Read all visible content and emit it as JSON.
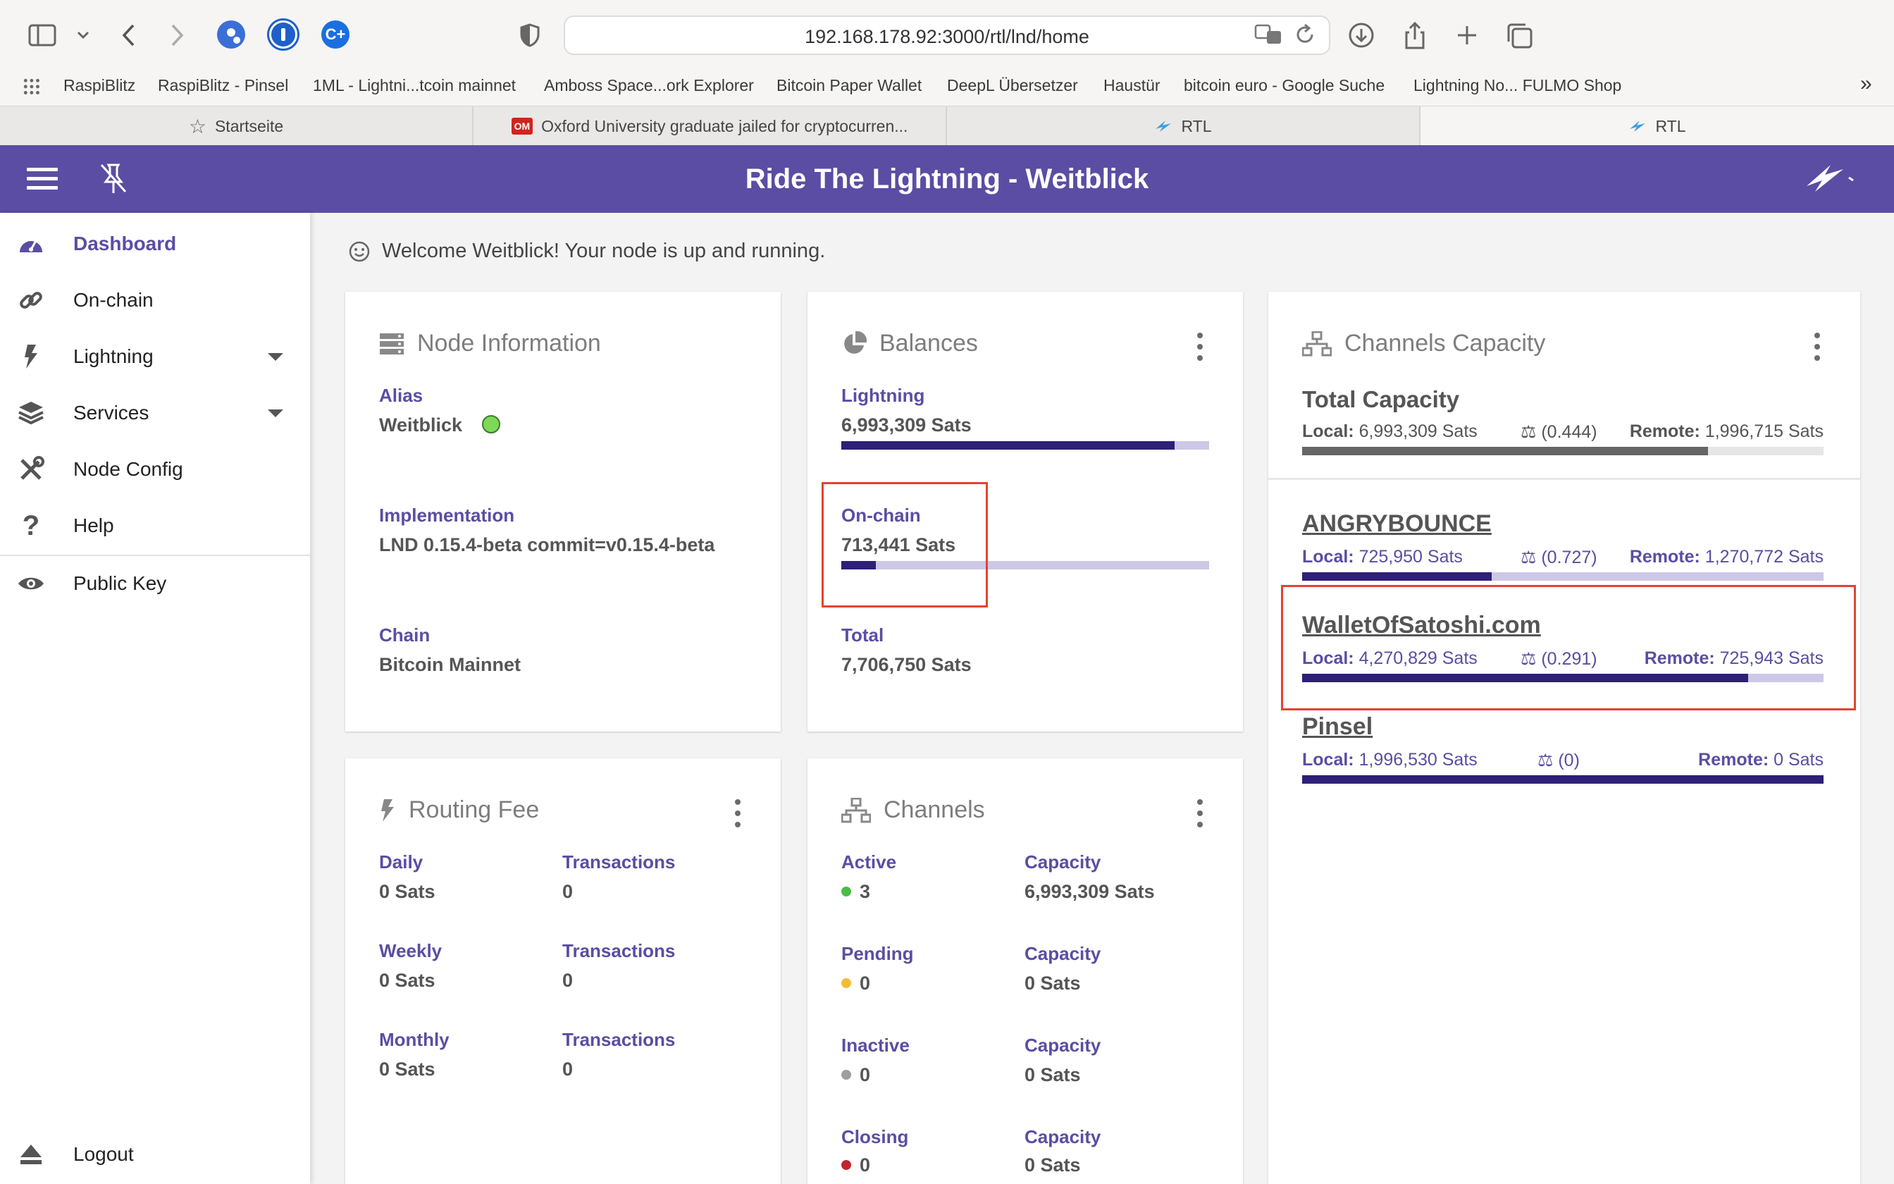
{
  "browser": {
    "url": "192.168.178.92:3000/rtl/lnd/home",
    "bookmarks": [
      "RaspiBlitz",
      "RaspiBlitz - Pinsel",
      "1ML - Lightni...tcoin mainnet",
      "Amboss Space...ork Explorer",
      "Bitcoin Paper Wallet",
      "DeepL Übersetzer",
      "Haustür",
      "bitcoin euro - Google Suche",
      "Lightning No... FULMO Shop"
    ],
    "tabs": [
      {
        "label": "Startseite",
        "icon": "star-icon"
      },
      {
        "label": "Oxford University graduate jailed for cryptocurren...",
        "icon": "om-favicon"
      },
      {
        "label": "RTL",
        "icon": "rtl-favicon"
      },
      {
        "label": "RTL",
        "icon": "rtl-favicon"
      }
    ],
    "extension_badge": "C+"
  },
  "app": {
    "title": "Ride The Lightning - Weitblick",
    "welcome": "Welcome Weitblick! Your node is up and running."
  },
  "sidebar": {
    "items": [
      {
        "label": "Dashboard",
        "icon": "dashboard-icon"
      },
      {
        "label": "On-chain",
        "icon": "link-icon"
      },
      {
        "label": "Lightning",
        "icon": "bolt-icon"
      },
      {
        "label": "Services",
        "icon": "layers-icon"
      },
      {
        "label": "Node Config",
        "icon": "tools-icon"
      },
      {
        "label": "Help",
        "icon": "help-icon"
      },
      {
        "label": "Public Key",
        "icon": "eye-icon"
      }
    ],
    "logout": "Logout"
  },
  "node_info": {
    "title": "Node Information",
    "alias_label": "Alias",
    "alias": "Weitblick",
    "alias_color": "#7ed957",
    "impl_label": "Implementation",
    "impl": "LND 0.15.4-beta commit=v0.15.4-beta",
    "chain_label": "Chain",
    "chain": "Bitcoin Mainnet"
  },
  "balances": {
    "title": "Balances",
    "lightning_label": "Lightning",
    "lightning": "6,993,309 Sats",
    "lightning_fraction": 0.907,
    "onchain_label": "On-chain",
    "onchain": "713,441 Sats",
    "onchain_fraction": 0.093,
    "total_label": "Total",
    "total": "7,706,750 Sats"
  },
  "channels_capacity": {
    "title": "Channels Capacity",
    "total_label": "Total Capacity",
    "local_key": "Local:",
    "remote_key": "Remote:",
    "total_local": "6,993,309 Sats",
    "total_ratio": "(0.444)",
    "total_remote": "1,996,715 Sats",
    "total_fraction": 0.778,
    "channels": [
      {
        "name": "ANGRYBOUNCE",
        "local": "725,950 Sats",
        "ratio": "(0.727)",
        "remote": "1,270,772 Sats",
        "fraction": 0.364
      },
      {
        "name": "WalletOfSatoshi.com",
        "local": "4,270,829 Sats",
        "ratio": "(0.291)",
        "remote": "725,943 Sats",
        "fraction": 0.855
      },
      {
        "name": "Pinsel",
        "local": "1,996,530 Sats",
        "ratio": "(0)",
        "remote": "0 Sats",
        "fraction": 1.0
      }
    ]
  },
  "routing_fee": {
    "title": "Routing Fee",
    "rows": [
      {
        "period": "Daily",
        "amount": "0 Sats",
        "tx_label": "Transactions",
        "tx": "0"
      },
      {
        "period": "Weekly",
        "amount": "0 Sats",
        "tx_label": "Transactions",
        "tx": "0"
      },
      {
        "period": "Monthly",
        "amount": "0 Sats",
        "tx_label": "Transactions",
        "tx": "0"
      }
    ]
  },
  "channels": {
    "title": "Channels",
    "rows": [
      {
        "status": "Active",
        "count": "3",
        "color": "#4cbb4c",
        "cap_label": "Capacity",
        "capacity": "6,993,309 Sats"
      },
      {
        "status": "Pending",
        "count": "0",
        "color": "#f3bd33",
        "cap_label": "Capacity",
        "capacity": "0 Sats"
      },
      {
        "status": "Inactive",
        "count": "0",
        "color": "#9e9e9e",
        "cap_label": "Capacity",
        "capacity": "0 Sats"
      },
      {
        "status": "Closing",
        "count": "0",
        "color": "#c0262d",
        "cap_label": "Capacity",
        "capacity": "0 Sats"
      }
    ]
  }
}
